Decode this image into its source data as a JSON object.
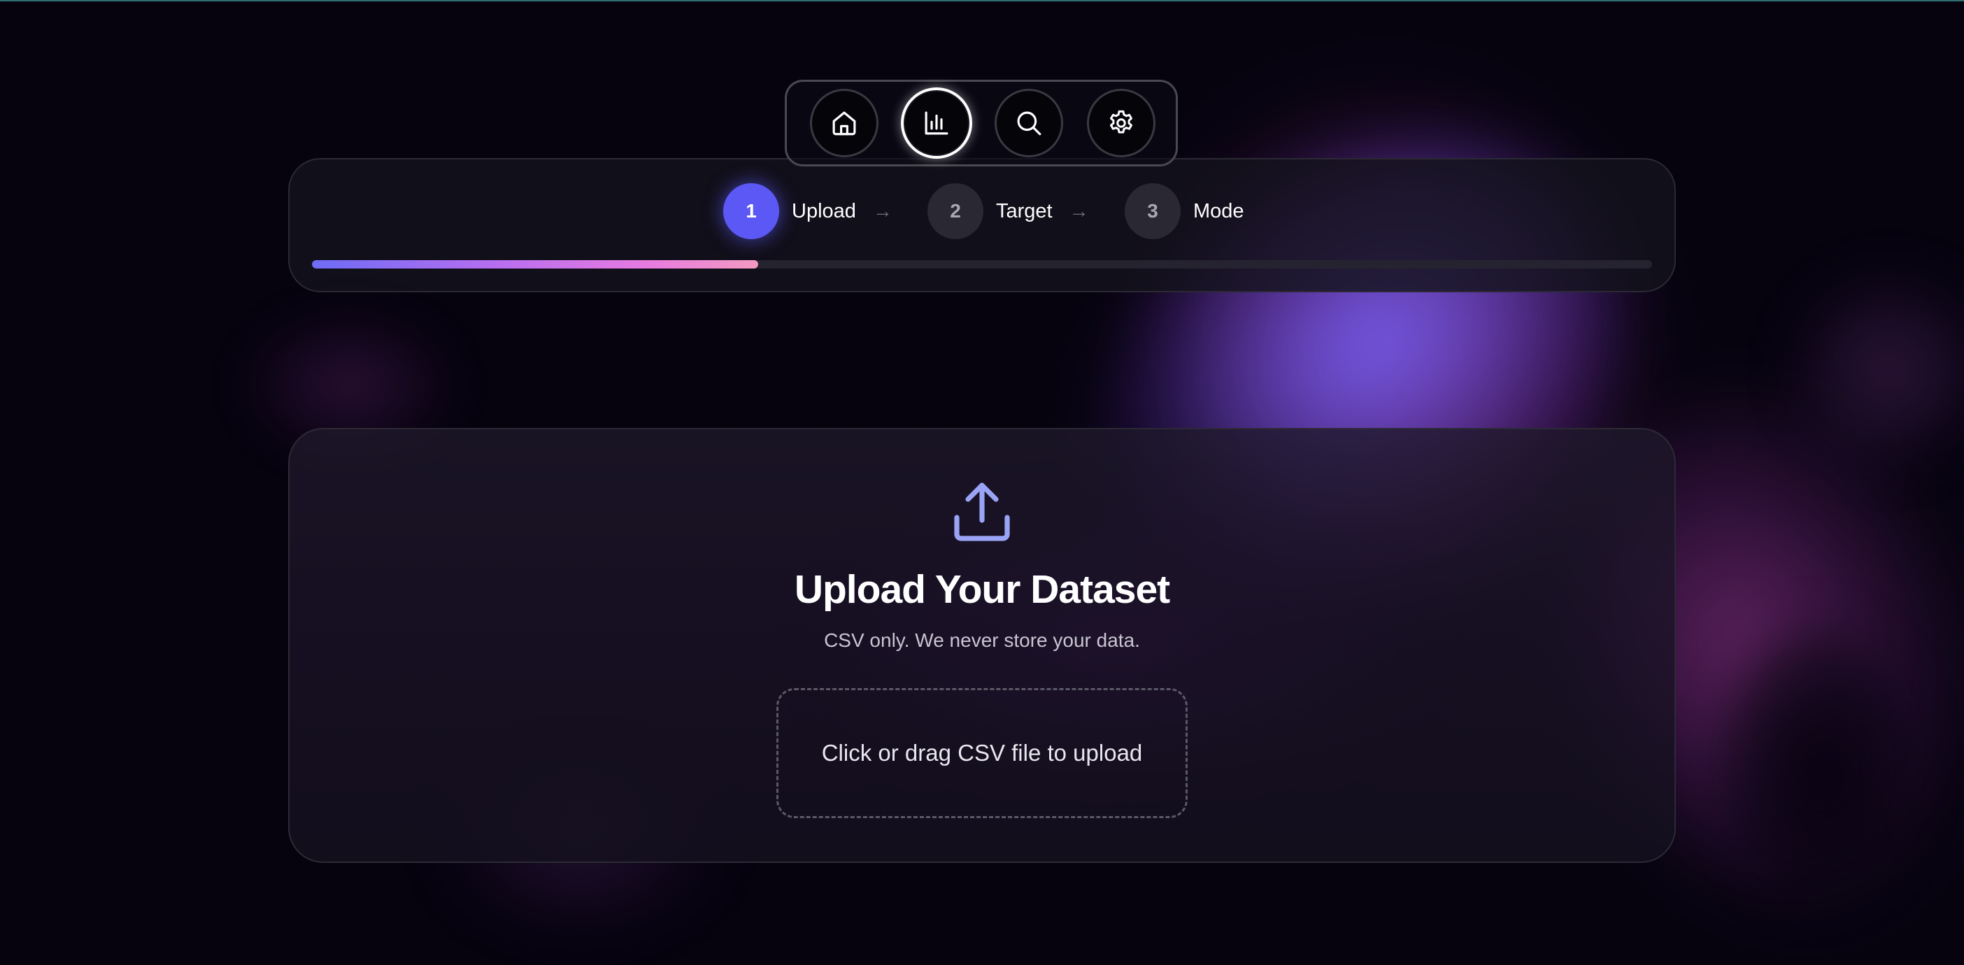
{
  "nav": {
    "items": [
      {
        "icon": "home-icon",
        "active": false
      },
      {
        "icon": "bar-chart-icon",
        "active": true
      },
      {
        "icon": "search-icon",
        "active": false
      },
      {
        "icon": "gear-icon",
        "active": false
      }
    ]
  },
  "stepper": {
    "steps": [
      {
        "number": "1",
        "label": "Upload",
        "active": true
      },
      {
        "number": "2",
        "label": "Target",
        "active": false
      },
      {
        "number": "3",
        "label": "Mode",
        "active": false
      }
    ],
    "arrow": "→",
    "progress": 0.333
  },
  "upload": {
    "icon": "upload-icon",
    "title": "Upload Your Dataset",
    "subtitle": "CSV only. We never store your data.",
    "dropzone_label": "Click or drag CSV file to upload"
  },
  "colors": {
    "background": "#06030f",
    "accent": "#5c58f5",
    "progress_start": "#6d6cf6",
    "progress_end": "#f49ac2",
    "icon_accent": "#9aa4f5"
  }
}
